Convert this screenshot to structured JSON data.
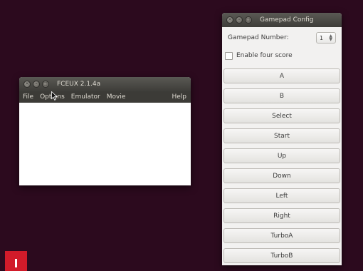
{
  "fceux": {
    "title": "FCEUX 2.1.4a",
    "menu": [
      "File",
      "Options",
      "Emulator",
      "Movie"
    ],
    "help": "Help"
  },
  "gamepad": {
    "title": "Gamepad Config",
    "number_label": "Gamepad Number:",
    "number_value": "1",
    "four_score_label": "Enable four score",
    "four_score_checked": false,
    "buttons": [
      "A",
      "B",
      "Select",
      "Start",
      "Up",
      "Down",
      "Left",
      "Right",
      "TurboA",
      "TurboB"
    ]
  },
  "icons": [
    "close-icon",
    "minimize-icon",
    "maximize-icon",
    "spin-arrows-icon",
    "mouse-pointer-icon"
  ],
  "colors": {
    "desktop": "#2c0a1e",
    "titlebar": "#3c3b37",
    "badge": "#d11b2a"
  }
}
